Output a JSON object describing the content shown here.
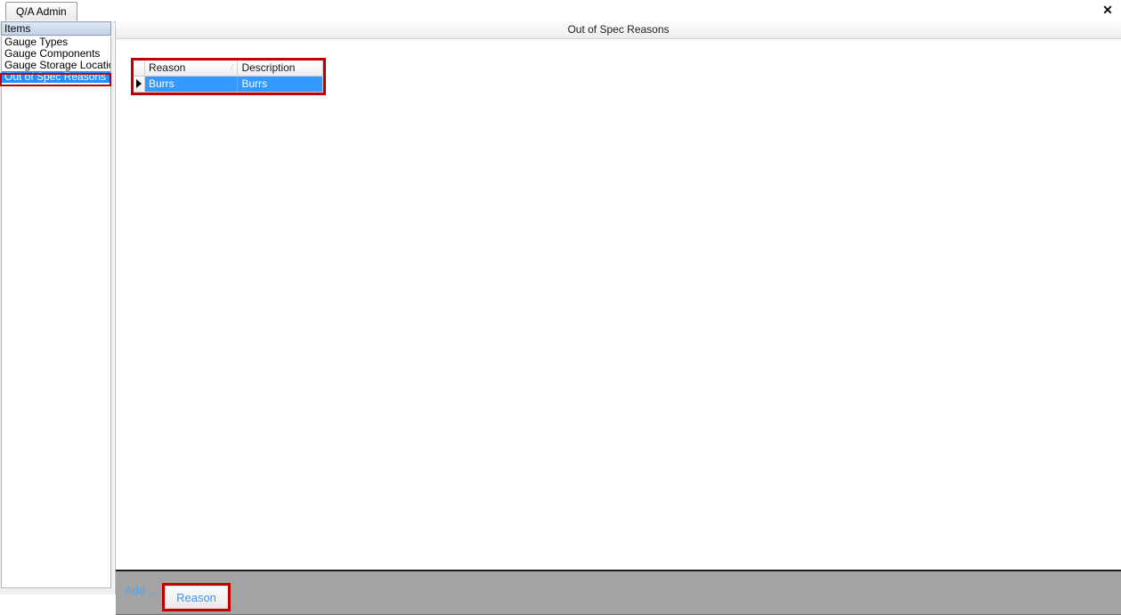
{
  "window": {
    "close_icon": "✕"
  },
  "tabs": [
    {
      "label": "Q/A Admin"
    }
  ],
  "sidebar": {
    "header": "Items",
    "items": [
      {
        "label": "Gauge Types",
        "selected": false
      },
      {
        "label": "Gauge Components",
        "selected": false
      },
      {
        "label": "Gauge Storage Locations",
        "selected": false
      },
      {
        "label": "Out of Spec Reasons",
        "selected": true
      }
    ]
  },
  "main": {
    "panel_title": "Out of Spec Reasons",
    "grid": {
      "columns": [
        {
          "label": "Reason",
          "sort": "ascending"
        },
        {
          "label": "Description",
          "sort": "none"
        }
      ],
      "sort_glyph": "⁄",
      "row_indicator_glyph": "▶",
      "rows": [
        {
          "reason": "Burrs",
          "description": "Burrs",
          "selected": true
        }
      ]
    }
  },
  "toolbar": {
    "add_label": "Add ...",
    "reason_button": "Reason"
  },
  "colors": {
    "selection_blue": "#3399ff",
    "highlight_red": "#c00000",
    "toolbar_gray": "#a3a3a3",
    "link_blue": "#3d95f5"
  }
}
